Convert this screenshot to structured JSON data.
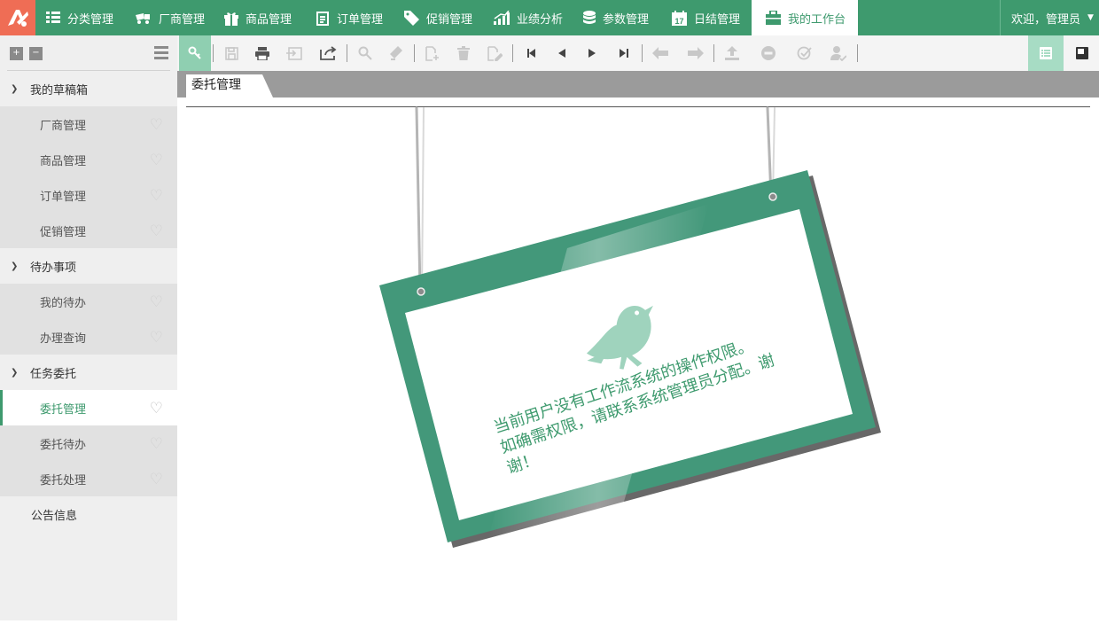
{
  "nav": {
    "items": [
      {
        "label": "分类管理",
        "icon": "grid-icon"
      },
      {
        "label": "厂商管理",
        "icon": "truck-icon"
      },
      {
        "label": "商品管理",
        "icon": "gift-icon"
      },
      {
        "label": "订单管理",
        "icon": "clipboard-icon"
      },
      {
        "label": "促销管理",
        "icon": "tag-icon"
      },
      {
        "label": "业绩分析",
        "icon": "chart-icon"
      },
      {
        "label": "参数管理",
        "icon": "database-icon"
      },
      {
        "label": "日结管理",
        "icon": "calendar-icon"
      },
      {
        "label": "我的工作台",
        "icon": "briefcase-icon"
      }
    ],
    "active_index": 8,
    "user_label": "欢迎，管理员",
    "calendar_day": "17"
  },
  "sidebar": {
    "expand_all": "+",
    "collapse_all": "−",
    "groups": [
      {
        "label": "我的草稿箱",
        "items": [
          "厂商管理",
          "商品管理",
          "订单管理",
          "促销管理"
        ]
      },
      {
        "label": "待办事项",
        "items": [
          "我的待办",
          "办理查询"
        ]
      },
      {
        "label": "任务委托",
        "items": [
          "委托管理",
          "委托待办",
          "委托处理"
        ]
      }
    ],
    "active_item": "委托管理",
    "plain_item": "公告信息"
  },
  "toolbar": {
    "buttons": [
      "key-search-icon",
      "save-icon",
      "print-icon",
      "import-icon",
      "export-icon",
      "search-icon",
      "eraser-icon",
      "add-doc-icon",
      "trash-icon",
      "edit-doc-icon",
      "first-page-icon",
      "prev-page-icon",
      "next-page-icon",
      "last-page-icon",
      "arrow-left-icon",
      "arrow-right-icon",
      "upload-icon",
      "minus-circle-icon",
      "check-circle-icon",
      "user-assign-icon"
    ]
  },
  "tab": {
    "label": "委托管理"
  },
  "sign": {
    "line1": "当前用户没有工作流系统的操作权限。",
    "line2": "如确需权限，请联系系统管理员分配。谢谢！"
  },
  "colors": {
    "brand_green": "#3e9a6e",
    "logo_orange": "#ef6d55"
  }
}
